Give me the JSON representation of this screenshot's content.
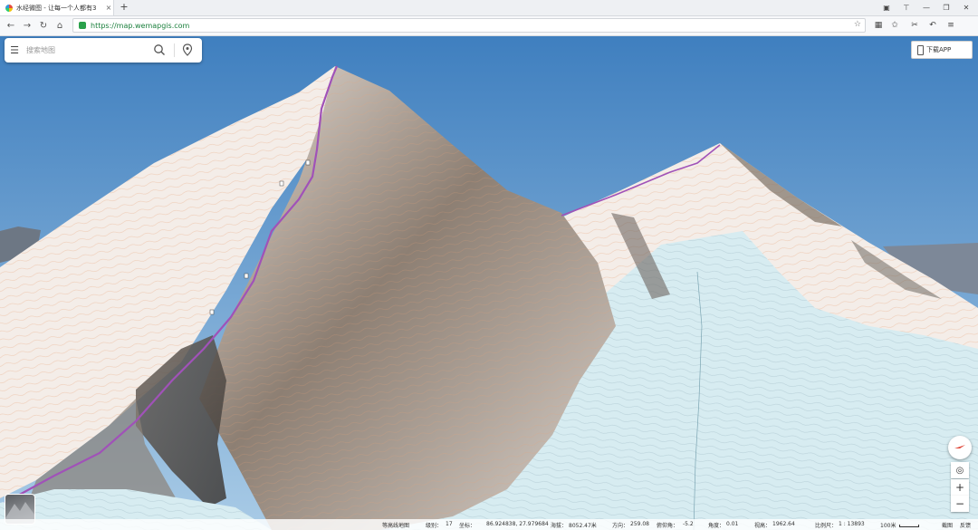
{
  "browser": {
    "tab_title": "水经微图 - 让每一个人都有3",
    "tab_close": "×",
    "new_tab": "+",
    "url": "https://map.wemapgis.com"
  },
  "search": {
    "placeholder": "搜索地图"
  },
  "app_button": {
    "label": "下载APP"
  },
  "map_controls": {
    "zoom_in": "+",
    "zoom_out": "−"
  },
  "status_bar": {
    "layer": "等高线地图",
    "level_label": "级别：",
    "level": "17",
    "coords_label": "坐标：",
    "coords": "86.924838, 27.979684",
    "elevation_label": "海拔：",
    "elevation": "8052.47米",
    "heading_label": "方向：",
    "heading": "259.08",
    "pitch_label": "俯仰角：",
    "pitch": "-5.2",
    "roll_label": "角度：",
    "roll": "0.01",
    "altitude_label": "视高：",
    "altitude": "1962.64",
    "scale_label": "比例尺：",
    "scale": "1 : 13893",
    "scale_bar": "100米",
    "link_view": "截图",
    "link_help": "反馈"
  },
  "colors": {
    "sky_top": "#3f7fbf",
    "sky_bottom": "#a9cbe6",
    "snow": "#f4ede8",
    "glacier": "#d7ecf1",
    "rock": "#8a7d72",
    "route": "#a052b8"
  }
}
